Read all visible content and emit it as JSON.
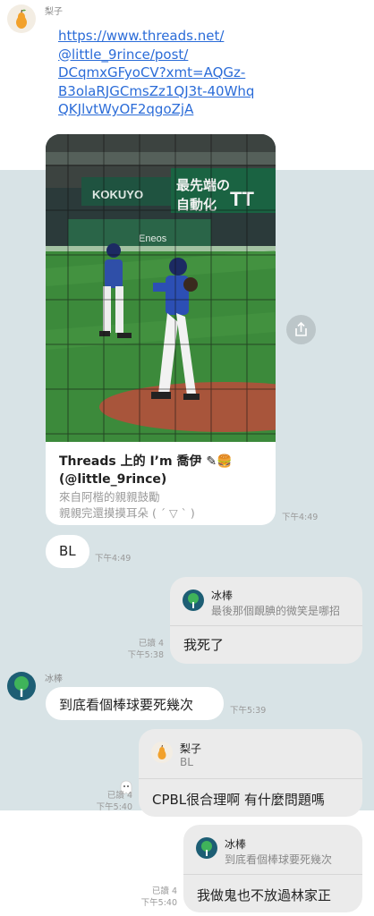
{
  "messages": {
    "m1": {
      "sender": "梨子",
      "link": "https://www.threads.net/@little_9rince/post/DCqmxGFyoCV?xmt=AQGz-B3olaRJGCmsZz1QJ3t-40WhqQKJlvtWyOF2qgoZjA",
      "link_lines": [
        "https://www.threads.net/",
        "@little_9rince/post/",
        "DCqmxGFyoCV?xmt=AQGz-",
        "B3olaRJGCmsZz1QJ3t-40Whq",
        "QKJlvtWyOF2qgoZjA"
      ]
    },
    "card": {
      "title": "Threads 上的 I’m 喬伊 ✎🍔",
      "handle": "(@little_9rince)",
      "desc1": "來自阿楷的親親鼓勵",
      "desc2": "親親完還摸摸耳朵 ( ´ ▽ ` )",
      "time": "下午4:49",
      "image_description": "baseball pitcher on field",
      "share_icon": "share-icon"
    },
    "m2": {
      "text": "BL",
      "time": "下午4:49"
    },
    "m3": {
      "reply_name": "冰棒",
      "reply_quote": "最後那個靦腆的微笑是哪招",
      "text": "我死了",
      "read": "已讀 4",
      "time": "下午5:38"
    },
    "m4": {
      "sender": "冰棒",
      "text": "到底看個棒球要死幾次",
      "time": "下午5:39"
    },
    "m5": {
      "reply_name": "梨子",
      "reply_quote": "BL",
      "text": "CPBL很合理啊 有什麼問題嗎",
      "read": "已讀 4",
      "time": "下午5:40"
    },
    "m6": {
      "reply_name": "冰棒",
      "reply_quote": "到底看個棒球要死幾次",
      "text": "我做鬼也不放過林家正",
      "read": "已讀 4",
      "time": "下午5:40"
    }
  }
}
